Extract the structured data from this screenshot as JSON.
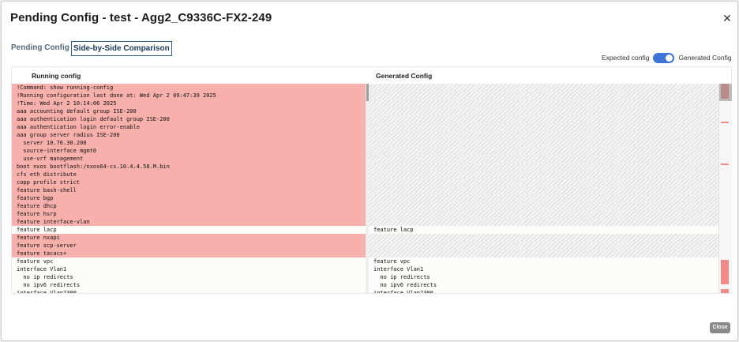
{
  "modal": {
    "title": "Pending Config - test - Agg2_C9336C-FX2-249"
  },
  "tabs": [
    {
      "label": "Pending Config"
    },
    {
      "label": "Side-by-Side Comparison"
    }
  ],
  "toggle": {
    "left_label": "Expected config",
    "right_label": "Generated Config",
    "on": true,
    "color": "#3d74d6"
  },
  "columns": {
    "left": "Running config",
    "right": "Generated Config"
  },
  "colors": {
    "deleted": "#f8b0ac",
    "minimap_mark": "#f28a8a"
  },
  "diff": {
    "rows": [
      {
        "type": "del",
        "left": "!Command: show running-config"
      },
      {
        "type": "del",
        "left": "!Running configuration last done at: Wed Apr 2 09:47:39 2025"
      },
      {
        "type": "del",
        "left": "!Time: Wed Apr 2 10:14:06 2025"
      },
      {
        "type": "del",
        "left": "aaa accounting default group ISE-200"
      },
      {
        "type": "del",
        "left": "aaa authentication login default group ISE-200"
      },
      {
        "type": "del",
        "left": "aaa authentication login error-enable"
      },
      {
        "type": "del",
        "left": "aaa group server radius ISE-200"
      },
      {
        "type": "del",
        "left": "  server 10.76.30.200"
      },
      {
        "type": "del",
        "left": "  source-interface mgmt0"
      },
      {
        "type": "del",
        "left": "  use-vrf management"
      },
      {
        "type": "del",
        "left": "boot nxos bootflash:/nxos64-cs.10.4.4.58.M.bin"
      },
      {
        "type": "del",
        "left": "cfs eth distribute"
      },
      {
        "type": "del",
        "left": "copp profile strict"
      },
      {
        "type": "del",
        "left": "feature bash-shell"
      },
      {
        "type": "del",
        "left": "feature bgp"
      },
      {
        "type": "del",
        "left": "feature dhcp"
      },
      {
        "type": "del",
        "left": "feature hsrp"
      },
      {
        "type": "del",
        "left": "feature interface-vlan"
      },
      {
        "type": "same",
        "left": "feature lacp",
        "right": "feature lacp"
      },
      {
        "type": "del",
        "left": "feature nxapi"
      },
      {
        "type": "del",
        "left": "feature scp-server"
      },
      {
        "type": "del",
        "left": "feature tacacs+"
      },
      {
        "type": "same",
        "left": "feature vpc",
        "right": "feature vpc"
      },
      {
        "type": "same",
        "left": "interface Vlan1",
        "right": "interface Vlan1"
      },
      {
        "type": "same",
        "left": "  no ip redirects",
        "right": "  no ip redirects"
      },
      {
        "type": "same",
        "left": "  no ipv6 redirects",
        "right": "  no ipv6 redirects"
      },
      {
        "type": "same",
        "left": "interface Vlan2300",
        "right": "interface Vlan2300"
      }
    ]
  },
  "minimap": {
    "marks": [
      {
        "start": 0.0,
        "end": 0.07
      },
      {
        "start": 0.18,
        "end": 0.19
      },
      {
        "start": 0.38,
        "end": 0.39
      },
      {
        "start": 0.84,
        "end": 0.96
      },
      {
        "start": 0.98,
        "end": 1.0
      }
    ]
  },
  "footer": {
    "close_label": "Close"
  }
}
